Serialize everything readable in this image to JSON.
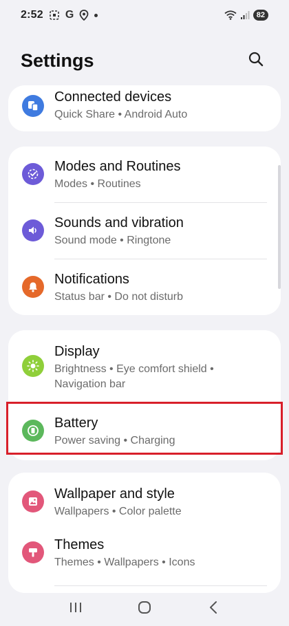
{
  "status_bar": {
    "time": "2:52",
    "google_letter": "G",
    "battery_level": "82",
    "icons": [
      "screenshot-icon",
      "google-icon",
      "location-icon",
      "dot-icon",
      "wifi-icon",
      "signal-icon",
      "battery-icon"
    ]
  },
  "header": {
    "title": "Settings",
    "search_icon": "search-icon"
  },
  "groups": [
    {
      "items": [
        {
          "label": "Connected devices",
          "sub": "Quick Share  •  Android Auto",
          "icon": "connected-devices-icon",
          "color": "#3f7be0"
        }
      ]
    },
    {
      "items": [
        {
          "label": "Modes and Routines",
          "sub": "Modes  •  Routines",
          "icon": "modes-routines-icon",
          "color": "#6d5bd8"
        },
        {
          "label": "Sounds and vibration",
          "sub": "Sound mode  •  Ringtone",
          "icon": "sound-icon",
          "color": "#6d5bd8"
        },
        {
          "label": "Notifications",
          "sub": "Status bar  •  Do not disturb",
          "icon": "bell-icon",
          "color": "#e5692a"
        }
      ]
    },
    {
      "items": [
        {
          "label": "Display",
          "sub": "Brightness  •  Eye comfort shield  •  Navigation bar",
          "icon": "brightness-icon",
          "color": "#8fcf3a"
        },
        {
          "label": "Battery",
          "sub": "Power saving  •  Charging",
          "icon": "battery-setting-icon",
          "color": "#5cb85c"
        }
      ]
    },
    {
      "items": [
        {
          "label": "Wallpaper and style",
          "sub": "Wallpapers  •  Color palette",
          "icon": "wallpaper-icon",
          "color": "#e2577a"
        },
        {
          "label": "Themes",
          "sub": "Themes  •  Wallpapers  •  Icons",
          "icon": "themes-icon",
          "color": "#e2577a"
        }
      ]
    }
  ],
  "nav_bar": {
    "buttons": [
      "recent-apps-icon",
      "home-icon",
      "back-icon"
    ]
  }
}
